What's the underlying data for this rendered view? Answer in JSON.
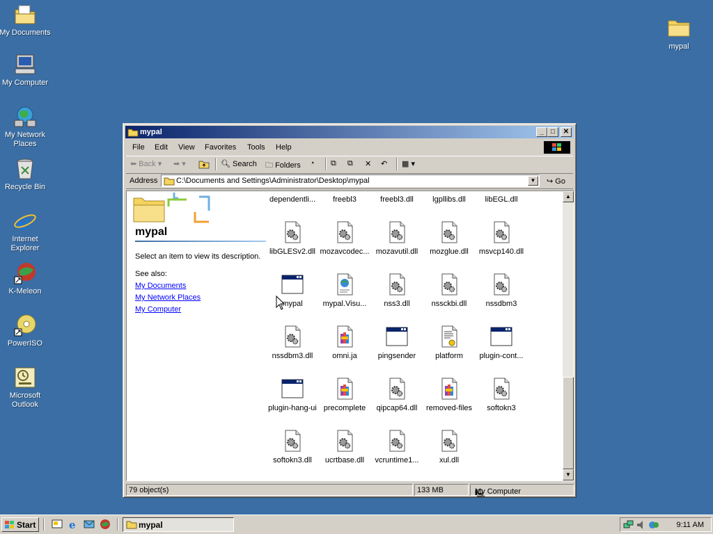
{
  "desktop": {
    "icons": [
      {
        "label": "My Documents"
      },
      {
        "label": "My Computer"
      },
      {
        "label": "My Network Places"
      },
      {
        "label": "Recycle Bin"
      },
      {
        "label": "Internet Explorer"
      },
      {
        "label": "K-Meleon"
      },
      {
        "label": "PowerISO"
      },
      {
        "label": "Microsoft Outlook"
      },
      {
        "label": "mypal"
      }
    ]
  },
  "window": {
    "title": "mypal",
    "menu": [
      "File",
      "Edit",
      "View",
      "Favorites",
      "Tools",
      "Help"
    ],
    "toolbar": {
      "back": "Back",
      "search": "Search",
      "folders": "Folders"
    },
    "address": {
      "label": "Address",
      "value": "C:\\Documents and Settings\\Administrator\\Desktop\\mypal",
      "go": "Go"
    },
    "left_pane": {
      "title": "mypal",
      "description": "Select an item to view its description.",
      "see_also": "See also:",
      "links": [
        "My Documents",
        "My Network Places",
        "My Computer"
      ]
    },
    "files": [
      {
        "name": "dependentli...",
        "type": "dll"
      },
      {
        "name": "freebl3",
        "type": "dll"
      },
      {
        "name": "freebl3.dll",
        "type": "dll"
      },
      {
        "name": "lgpllibs.dll",
        "type": "dll"
      },
      {
        "name": "libEGL.dll",
        "type": "dll"
      },
      {
        "name": "libGLESv2.dll",
        "type": "dll"
      },
      {
        "name": "mozavcodec...",
        "type": "dll"
      },
      {
        "name": "mozavutil.dll",
        "type": "dll"
      },
      {
        "name": "mozglue.dll",
        "type": "dll"
      },
      {
        "name": "msvcp140.dll",
        "type": "dll"
      },
      {
        "name": "mypal",
        "type": "app"
      },
      {
        "name": "mypal.Visu...",
        "type": "manifest"
      },
      {
        "name": "nss3.dll",
        "type": "dll"
      },
      {
        "name": "nssckbi.dll",
        "type": "dll"
      },
      {
        "name": "nssdbm3",
        "type": "dll"
      },
      {
        "name": "nssdbm3.dll",
        "type": "dll"
      },
      {
        "name": "omni.ja",
        "type": "archive"
      },
      {
        "name": "pingsender",
        "type": "app"
      },
      {
        "name": "platform",
        "type": "ini"
      },
      {
        "name": "plugin-cont...",
        "type": "app"
      },
      {
        "name": "plugin-hang-ui",
        "type": "app"
      },
      {
        "name": "precomplete",
        "type": "archive"
      },
      {
        "name": "qipcap64.dll",
        "type": "dll"
      },
      {
        "name": "removed-files",
        "type": "archive"
      },
      {
        "name": "softokn3",
        "type": "dll"
      },
      {
        "name": "softokn3.dll",
        "type": "dll"
      },
      {
        "name": "ucrtbase.dll",
        "type": "dll"
      },
      {
        "name": "vcruntime1...",
        "type": "dll"
      },
      {
        "name": "xul.dll",
        "type": "dll"
      }
    ],
    "status": {
      "objects": "79 object(s)",
      "size": "133 MB",
      "zone": "My Computer"
    }
  },
  "taskbar": {
    "start": "Start",
    "task": "mypal",
    "clock": "9:11 AM"
  },
  "colors": {
    "desktop": "#3a6ea5",
    "title_start": "#0a246a",
    "title_end": "#a6caf0",
    "link": "#0000ff"
  }
}
